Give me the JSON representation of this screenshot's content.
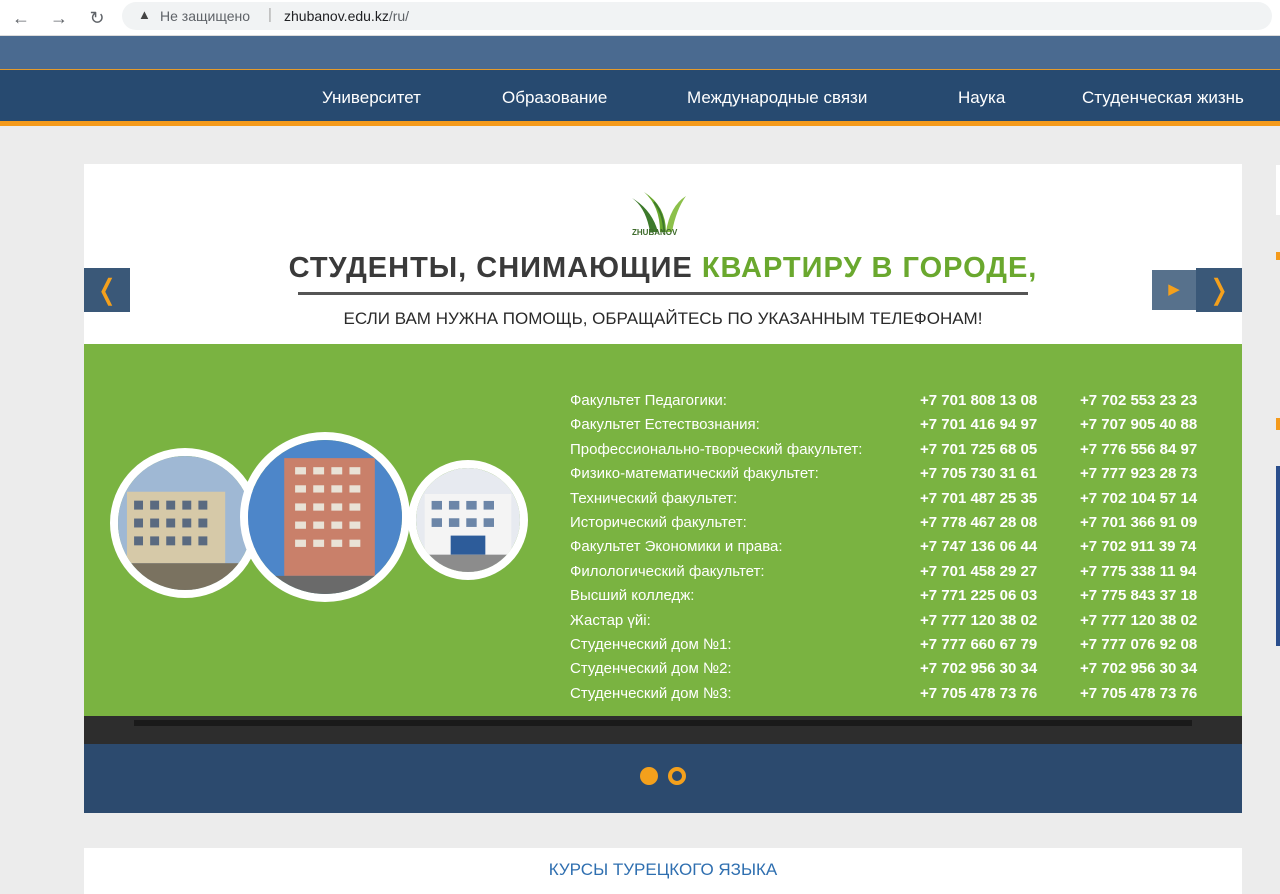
{
  "browser": {
    "back_icon": "arrow-left-icon",
    "forward_icon": "arrow-right-icon",
    "reload_icon": "reload-icon",
    "security_label": "Не защищено",
    "url_domain": "zhubanov.edu.kz",
    "url_path": "/ru/"
  },
  "nav": {
    "items": [
      {
        "label": "Университет"
      },
      {
        "label": "Образование"
      },
      {
        "label": "Международные связи"
      },
      {
        "label": "Наука"
      },
      {
        "label": "Студенческая жизнь"
      }
    ]
  },
  "slide": {
    "logo_text": "ZHUBANOV",
    "headline_part1": "СТУДЕНТЫ, СНИМАЮЩИЕ ",
    "headline_part2": "КВАРТИРУ В ГОРОДЕ,",
    "subline": "ЕСЛИ ВАМ НУЖНА ПОМОЩЬ, ОБРАЩАЙТЕСЬ ПО УКАЗАННЫМ ТЕЛЕФОНАМ!",
    "rows": [
      {
        "faculty": "Факультет Педагогики:",
        "phone1": "+7 701 808 13 08",
        "phone2": "+7 702 553 23 23"
      },
      {
        "faculty": "Факультет Естествознания:",
        "phone1": "+7 701 416 94 97",
        "phone2": "+7 707 905 40 88"
      },
      {
        "faculty": "Профессионально-творческий факультет:",
        "phone1": "+7 701 725 68 05",
        "phone2": "+7 776 556 84 97"
      },
      {
        "faculty": "Физико-математический факультет:",
        "phone1": "+7 705 730 31 61",
        "phone2": "+7 777 923 28 73"
      },
      {
        "faculty": "Технический факультет:",
        "phone1": "+7 701 487 25 35",
        "phone2": "+7 702 104 57 14"
      },
      {
        "faculty": "Исторический факультет:",
        "phone1": "+7 778 467 28 08",
        "phone2": "+7 701 366 91 09"
      },
      {
        "faculty": "Факультет Экономики и права:",
        "phone1": "+7 747 136 06 44",
        "phone2": "+7 702 911 39 74"
      },
      {
        "faculty": "Филологический факультет:",
        "phone1": "+7 701 458 29 27",
        "phone2": "+7 775 338 11 94"
      },
      {
        "faculty": "Высший колледж:",
        "phone1": "+7 771 225 06 03",
        "phone2": "+7 775 843 37 18"
      },
      {
        "faculty": "Жастар үйі:",
        "phone1": "+7 777 120 38 02",
        "phone2": "+7 777 120 38 02"
      },
      {
        "faculty": "Студенческий дом №1:",
        "phone1": "+7 777 660 67 79",
        "phone2": "+7 777 076 92 08"
      },
      {
        "faculty": "Студенческий дом №2:",
        "phone1": "+7 702 956 30 34",
        "phone2": "+7 702 956 30 34"
      },
      {
        "faculty": "Студенческий дом №3:",
        "phone1": "+7 705 478 73 76",
        "phone2": "+7 705 478 73 76"
      }
    ]
  },
  "slider": {
    "prev_icon": "chevron-left-icon",
    "prev_glyph": "❬",
    "next_icon": "chevron-right-icon",
    "next_glyph": "❭",
    "play_icon": "play-icon",
    "play_glyph": "▶",
    "dots": 2,
    "active_dot": 1
  },
  "course_bar": {
    "title": "КУРСЫ ТУРЕЦКОГО ЯЗЫКА"
  },
  "colors": {
    "nav_bg": "#274a70",
    "accent": "#f49a1b",
    "slide_green": "#7ab341"
  }
}
